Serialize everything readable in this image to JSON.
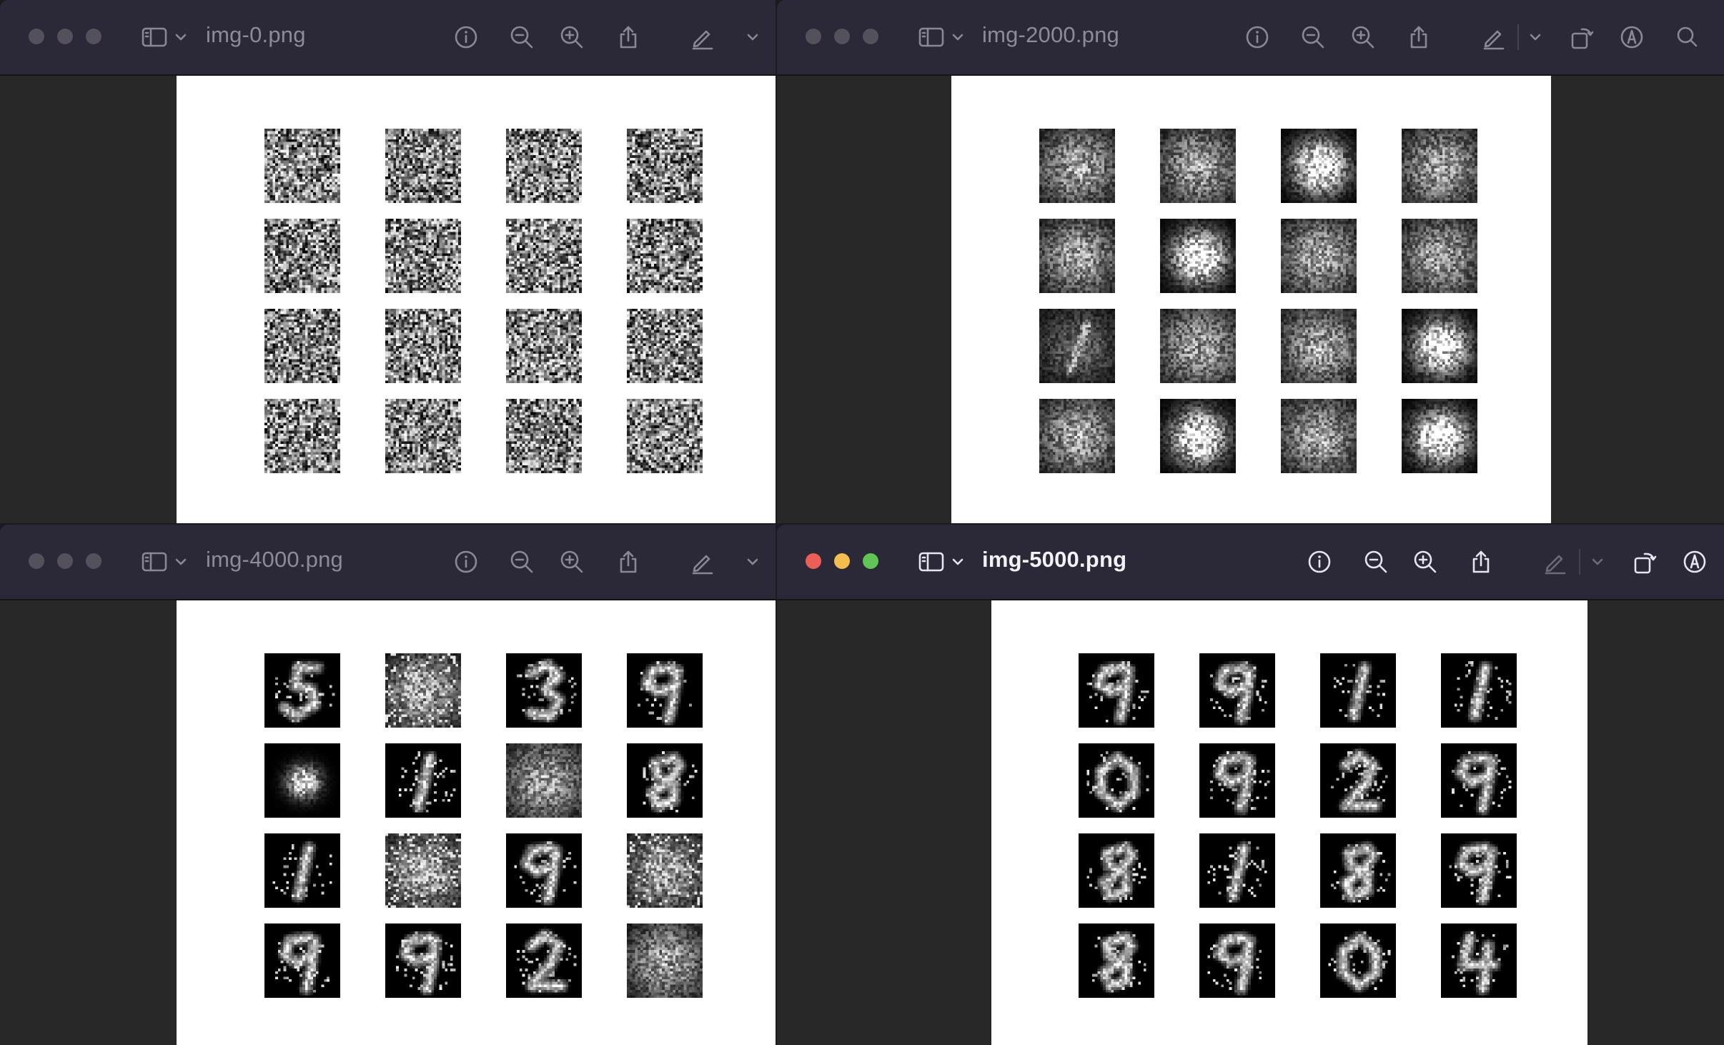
{
  "windows": [
    {
      "id": "w0",
      "title": "img-0.png",
      "active": false,
      "toolbar": [
        "sidebar-icon",
        "chevron-down-icon",
        "info-icon",
        "zoom-out-icon",
        "zoom-in-icon",
        "share-icon",
        "markup-pen-icon",
        "chevron-down-icon"
      ],
      "image": {
        "kind": "noise",
        "rows": 4,
        "cols": 4,
        "tiles": [
          {
            "digit": "noise"
          },
          {
            "digit": "noise"
          },
          {
            "digit": "noise"
          },
          {
            "digit": "noise"
          },
          {
            "digit": "noise"
          },
          {
            "digit": "noise"
          },
          {
            "digit": "noise"
          },
          {
            "digit": "noise"
          },
          {
            "digit": "noise"
          },
          {
            "digit": "noise"
          },
          {
            "digit": "noise"
          },
          {
            "digit": "noise"
          },
          {
            "digit": "noise"
          },
          {
            "digit": "noise"
          },
          {
            "digit": "noise"
          },
          {
            "digit": "noise"
          }
        ]
      }
    },
    {
      "id": "w1",
      "title": "img-2000.png",
      "active": false,
      "toolbar": [
        "sidebar-icon",
        "chevron-down-icon",
        "info-icon",
        "zoom-out-icon",
        "zoom-in-icon",
        "share-icon",
        "markup-pen-icon",
        "chevron-down-icon",
        "rotate-icon",
        "markup-icon",
        "search-icon"
      ],
      "image": {
        "kind": "blob",
        "rows": 4,
        "cols": 4,
        "tiles": [
          {
            "digit": "blob"
          },
          {
            "digit": "blob"
          },
          {
            "digit": "blob-sparse"
          },
          {
            "digit": "blob"
          },
          {
            "digit": "blob"
          },
          {
            "digit": "blob-sparse"
          },
          {
            "digit": "blob"
          },
          {
            "digit": "blob"
          },
          {
            "digit": "blob-slant"
          },
          {
            "digit": "blob"
          },
          {
            "digit": "blob"
          },
          {
            "digit": "blob-sparse"
          },
          {
            "digit": "blob"
          },
          {
            "digit": "blob-sparse"
          },
          {
            "digit": "blob"
          },
          {
            "digit": "blob-sparse"
          }
        ]
      }
    },
    {
      "id": "w2",
      "title": "img-4000.png",
      "active": false,
      "toolbar": [
        "sidebar-icon",
        "chevron-down-icon",
        "info-icon",
        "zoom-out-icon",
        "zoom-in-icon",
        "share-icon",
        "markup-pen-icon",
        "chevron-down-icon"
      ],
      "image": {
        "kind": "digits",
        "rows": 4,
        "cols": 4,
        "tiles": [
          {
            "digit": "5"
          },
          {
            "digit": "blob-speckle"
          },
          {
            "digit": "3"
          },
          {
            "digit": "9"
          },
          {
            "digit": "dot"
          },
          {
            "digit": "1"
          },
          {
            "digit": "blob"
          },
          {
            "digit": "8"
          },
          {
            "digit": "1"
          },
          {
            "digit": "blob-speckle"
          },
          {
            "digit": "9"
          },
          {
            "digit": "blob-speckle"
          },
          {
            "digit": "9"
          },
          {
            "digit": "9"
          },
          {
            "digit": "2"
          },
          {
            "digit": "blob"
          }
        ]
      }
    },
    {
      "id": "w3",
      "title": "img-5000.png",
      "active": true,
      "toolbar": [
        "sidebar-icon",
        "chevron-down-icon",
        "info-icon",
        "zoom-out-icon",
        "zoom-in-icon",
        "share-icon",
        "markup-pen-icon",
        "chevron-down-icon",
        "rotate-icon",
        "markup-icon"
      ],
      "image": {
        "kind": "digits",
        "rows": 4,
        "cols": 4,
        "tiles": [
          {
            "digit": "9"
          },
          {
            "digit": "9"
          },
          {
            "digit": "1"
          },
          {
            "digit": "1"
          },
          {
            "digit": "0"
          },
          {
            "digit": "9"
          },
          {
            "digit": "2"
          },
          {
            "digit": "9"
          },
          {
            "digit": "8"
          },
          {
            "digit": "1"
          },
          {
            "digit": "8"
          },
          {
            "digit": "9"
          },
          {
            "digit": "8"
          },
          {
            "digit": "9"
          },
          {
            "digit": "0"
          },
          {
            "digit": "4"
          }
        ]
      }
    }
  ]
}
